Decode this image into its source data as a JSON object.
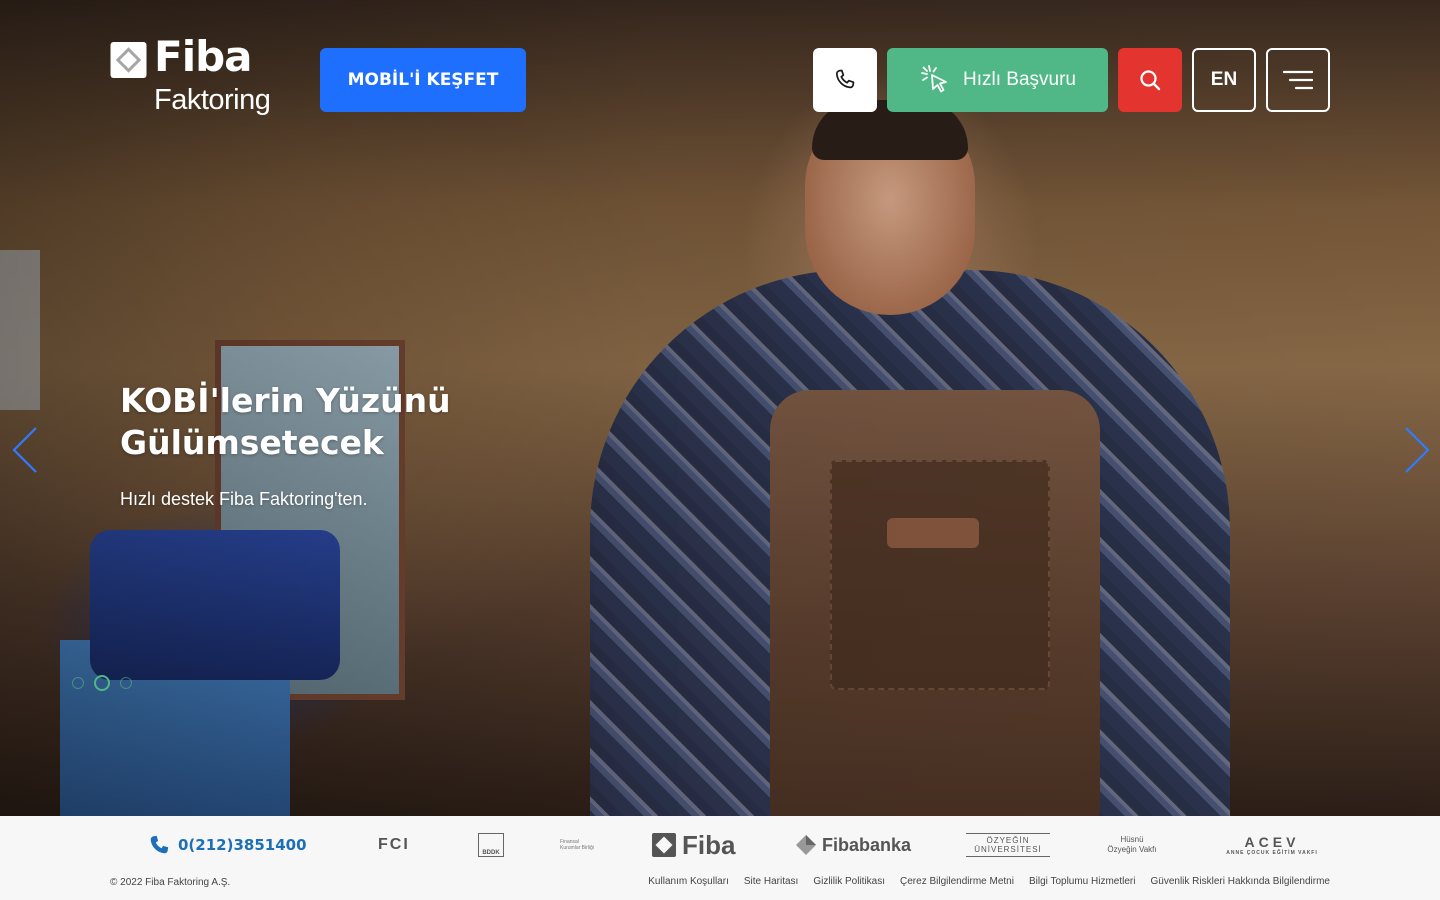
{
  "header": {
    "logo_main": "Fiba",
    "logo_sub": "Faktoring",
    "mobil_label": "MOBİL'İ KEŞFET",
    "hizli_label": "Hızlı Başvuru",
    "lang_label": "EN"
  },
  "hero": {
    "title": "KOBİ'lerin Yüzünü Gülümsetecek",
    "subtitle": "Hızlı destek Fiba Faktoring'ten.",
    "slides": 3,
    "active_slide": 2
  },
  "footer": {
    "phone": "0(212)3851400",
    "partners": {
      "fci": "FCI",
      "bddk": "BDDK",
      "fkb": "Finansal Kurumlar Birliği",
      "fiba": "Fiba",
      "fibabanka": "Fibabanka",
      "ozu_top": "ÖZYEĞİN",
      "ozu_bottom": "ÜNİVERSİTESİ",
      "husnu_top": "Hüsnü",
      "husnu_bottom": "Özyeğin Vakfı",
      "acev": "ACEV",
      "acev_sub": "ANNE ÇOCUK EĞİTİM VAKFI"
    },
    "copyright": "© 2022 Fiba Faktoring A.Ş.",
    "links": [
      "Kullanım Koşulları",
      "Site Haritası",
      "Gizlilik Politikası",
      "Çerez Bilgilendirme Metni",
      "Bilgi Toplumu Hizmetleri",
      "Güvenlik Riskleri Hakkında Bilgilendirme"
    ]
  },
  "colors": {
    "blue": "#1f6fff",
    "green": "#4fb886",
    "red": "#e3342f",
    "phone_blue": "#1d6fb8"
  }
}
